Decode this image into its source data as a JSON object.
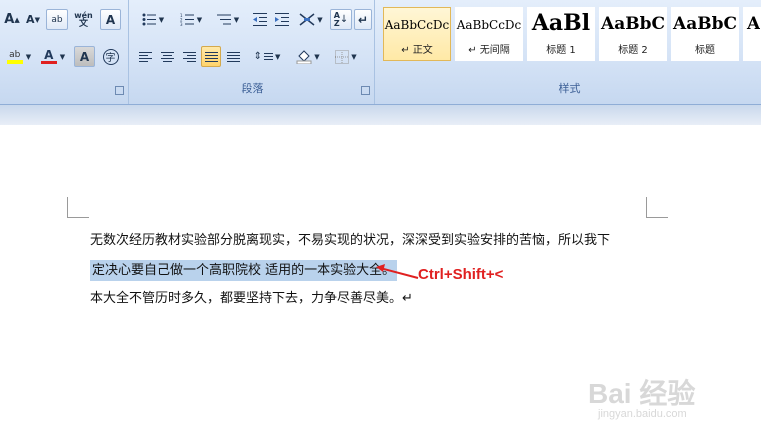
{
  "ribbon": {
    "font_group": {
      "grow_font": "A",
      "shrink_font": "A",
      "clear_format": "ab",
      "phonetic": "wén",
      "char_border": "A",
      "highlight_label": "ab",
      "font_color_label": "A",
      "char_shading": "A",
      "enclose_char": "字"
    },
    "paragraph_group": {
      "label": "段落"
    },
    "styles_group": {
      "label": "样式",
      "styles": [
        {
          "preview": "AaBbCcDc",
          "name": "↵ 正文",
          "active": true
        },
        {
          "preview": "AaBbCcDc",
          "name": "↵ 无间隔",
          "active": false
        },
        {
          "preview": "AaBl",
          "name": "标题 1",
          "active": false
        },
        {
          "preview": "AaBbC",
          "name": "标题 2",
          "active": false
        },
        {
          "preview": "AaBbC",
          "name": "标题",
          "active": false
        },
        {
          "preview": "A",
          "name": "",
          "active": false
        }
      ]
    }
  },
  "document": {
    "line1": "无数次经历教材实验部分脱离现实，不易实现的状况，深深受到实验安排的苦恼，所以我下",
    "line2": "定决心要自己做一个高职院校   适用的一本实验大全。",
    "line3": "本大全不管历时多久，都要坚持下去，力争尽善尽美。↵"
  },
  "annotation": {
    "text": "Ctrl+Shift+<"
  },
  "watermark": {
    "brand": "Bai 经验",
    "url": "jingyan.baidu.com"
  },
  "colors": {
    "highlight": "#ffff00",
    "font_color": "#e02020",
    "selection": "#b9d2ec",
    "annotation": "#e02020"
  }
}
